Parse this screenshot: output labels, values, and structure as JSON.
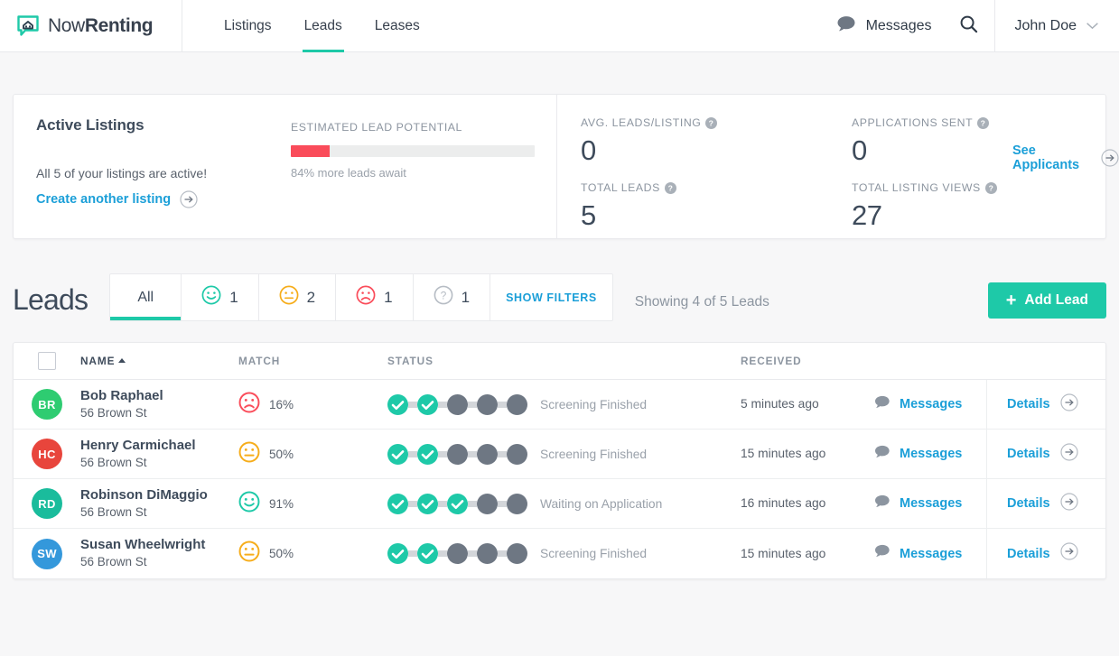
{
  "brand": {
    "name_light": "Now",
    "name_bold": "Renting",
    "logo_icon": "house-chat-logo-icon"
  },
  "nav": {
    "items": [
      {
        "label": "Listings",
        "active": false
      },
      {
        "label": "Leads",
        "active": true
      },
      {
        "label": "Leases",
        "active": false
      }
    ],
    "messages_label": "Messages",
    "messages_icon": "chat-bubble-icon",
    "search_icon": "search-icon",
    "user_name": "John Doe",
    "user_caret_icon": "chevron-down-icon"
  },
  "summary": {
    "active_listings": {
      "title": "Active Listings",
      "subtitle": "All 5 of your listings are active!",
      "link_label": "Create another listing",
      "link_arrow_icon": "arrow-right-circle-icon"
    },
    "lead_potential": {
      "label": "ESTIMATED LEAD POTENTIAL",
      "fill_percent": 16,
      "note": "84% more leads await",
      "fill_color": "#fa4c5a",
      "track_color": "#eceded"
    },
    "stats": [
      {
        "label": "AVG. LEADS/LISTING",
        "value": "0",
        "help_icon": "help-circle-icon"
      },
      {
        "label": "APPLICATIONS SENT",
        "value": "0",
        "help_icon": "help-circle-icon"
      },
      {
        "label": "TOTAL LEADS",
        "value": "5",
        "help_icon": "help-circle-icon"
      },
      {
        "label": "TOTAL LISTING VIEWS",
        "value": "27",
        "help_icon": "help-circle-icon"
      }
    ],
    "see_applicants": {
      "label": "See Applicants",
      "arrow_icon": "arrow-right-circle-icon"
    }
  },
  "leads_section": {
    "title": "Leads",
    "tabs": [
      {
        "label": "All",
        "icon": null,
        "count": null,
        "active": true
      },
      {
        "label": "",
        "icon": "smiley-happy-icon",
        "count": "1",
        "active": false
      },
      {
        "label": "",
        "icon": "smiley-neutral-icon",
        "count": "2",
        "active": false
      },
      {
        "label": "",
        "icon": "smiley-sad-icon",
        "count": "1",
        "active": false
      },
      {
        "label": "",
        "icon": "smiley-unknown-icon",
        "count": "1",
        "active": false
      }
    ],
    "show_filters_label": "SHOW FILTERS",
    "showing_text": "Showing 4 of 5 Leads",
    "add_lead_label": "Add Lead",
    "add_lead_icon": "plus-icon",
    "accent_color": "#1ec9a8"
  },
  "table": {
    "headers": {
      "name": "NAME",
      "match": "MATCH",
      "status": "STATUS",
      "received": "RECEIVED"
    },
    "sort_column": "NAME",
    "sort_direction": "asc",
    "select_all_checked": false,
    "messages_label": "Messages",
    "details_label": "Details",
    "messages_icon": "chat-bubble-icon",
    "details_arrow_icon": "arrow-right-circle-icon",
    "total_steps": 5,
    "rows": [
      {
        "initials": "BR",
        "avatar_color": "#2ecc71",
        "name": "Bob Raphael",
        "address": "56 Brown St",
        "match_icon": "smiley-sad-icon",
        "match_color": "#fa4c5a",
        "match_percent": "16%",
        "steps_done": 2,
        "status": "Screening Finished",
        "received": "5 minutes ago"
      },
      {
        "initials": "HC",
        "avatar_color": "#e8453c",
        "name": "Henry Carmichael",
        "address": "56 Brown St",
        "match_icon": "smiley-neutral-icon",
        "match_color": "#f6ad1b",
        "match_percent": "50%",
        "steps_done": 2,
        "status": "Screening Finished",
        "received": "15 minutes ago"
      },
      {
        "initials": "RD",
        "avatar_color": "#1abc9c",
        "name": "Robinson DiMaggio",
        "address": "56 Brown St",
        "match_icon": "smiley-happy-icon",
        "match_color": "#1ec9a8",
        "match_percent": "91%",
        "steps_done": 3,
        "status": "Waiting on Application",
        "received": "16 minutes ago"
      },
      {
        "initials": "SW",
        "avatar_color": "#3498db",
        "name": "Susan Wheelwright",
        "address": "56 Brown St",
        "match_icon": "smiley-neutral-icon",
        "match_color": "#f6ad1b",
        "match_percent": "50%",
        "steps_done": 2,
        "status": "Screening Finished",
        "received": "15 minutes ago"
      }
    ]
  }
}
